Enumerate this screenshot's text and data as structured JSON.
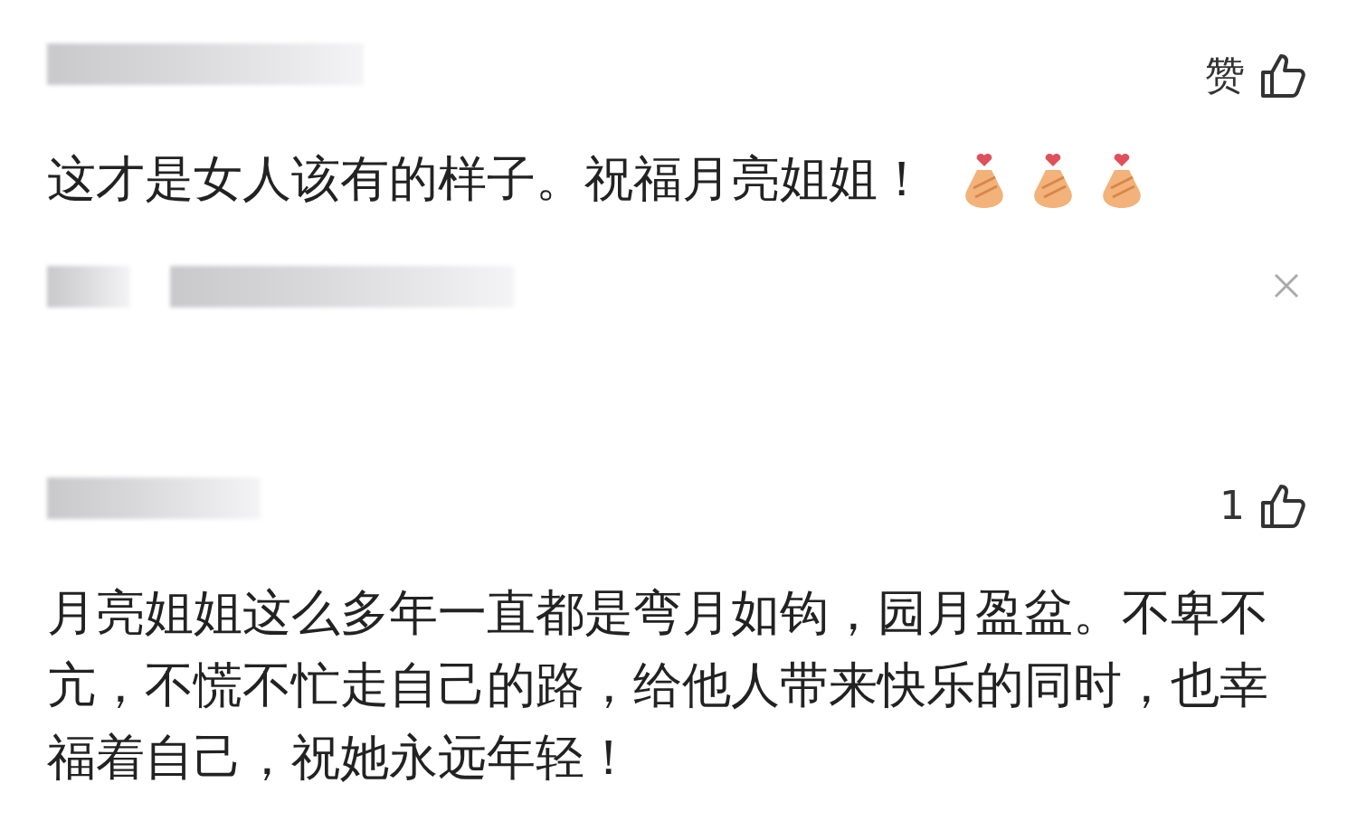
{
  "items": [
    {
      "kind": "comment",
      "like": "赞",
      "text": "这才是女人该有的样子。祝福月亮姐姐！",
      "emojis": [
        {
          "kind": "finger-heart"
        },
        {
          "kind": "finger-heart"
        },
        {
          "kind": "finger-heart"
        }
      ]
    },
    {
      "kind": "collapsed",
      "closable": true
    },
    {
      "kind": "comment",
      "like": "1",
      "text": "月亮姐姐这么多年一直都是弯月如钩，园月盈盆。不卑不亢，不慌不忙走自己的路，给他人带来快乐的同时，也幸福着自己，祝她永远年轻！"
    }
  ]
}
